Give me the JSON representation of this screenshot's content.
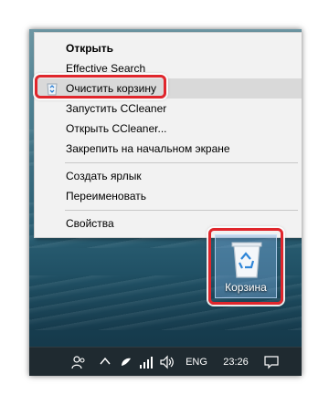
{
  "context_menu": {
    "items": [
      {
        "label": "Открыть",
        "bold": true
      },
      {
        "label": "Effective Search"
      },
      {
        "label": "Очистить корзину",
        "highlighted": true,
        "icon": "recycle-bin-small-icon"
      },
      {
        "label": "Запустить CCleaner"
      },
      {
        "label": "Открыть CCleaner..."
      },
      {
        "label": "Закрепить на начальном экране"
      },
      {
        "label": "Создать ярлык"
      },
      {
        "label": "Переименовать"
      },
      {
        "label": "Свойства"
      }
    ]
  },
  "desktop": {
    "icon_label": "Корзина",
    "icon": "recycle-bin-icon"
  },
  "taskbar": {
    "language": "ENG",
    "time": "23:26",
    "icons": [
      "people-icon",
      "chevron-up-icon",
      "sync-icon",
      "network-icon",
      "volume-icon",
      "notifications-icon"
    ]
  },
  "colors": {
    "highlight_ring": "#e0262c",
    "menu_background": "#f2f2f2",
    "menu_highlight": "#d9d9d9",
    "taskbar": "#1f2a30"
  }
}
